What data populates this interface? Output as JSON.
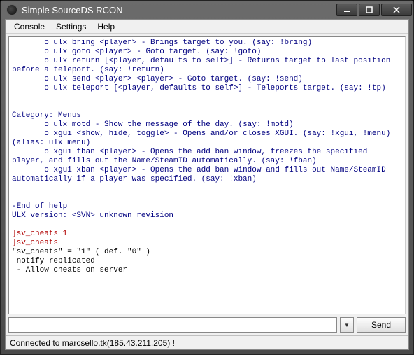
{
  "window": {
    "title": "Simple SourceDS RCON"
  },
  "menu": {
    "console": "Console",
    "settings": "Settings",
    "help": "Help"
  },
  "console": {
    "lines": [
      {
        "c": "blue",
        "t": "       o ulx bring <player> - Brings target to you. (say: !bring)"
      },
      {
        "c": "blue",
        "t": "       o ulx goto <player> - Goto target. (say: !goto)"
      },
      {
        "c": "blue",
        "t": "       o ulx return [<player, defaults to self>] - Returns target to last position before a teleport. (say: !return)"
      },
      {
        "c": "blue",
        "t": "       o ulx send <player> <player> - Goto target. (say: !send)"
      },
      {
        "c": "blue",
        "t": "       o ulx teleport [<player, defaults to self>] - Teleports target. (say: !tp)"
      },
      {
        "c": "blue",
        "t": ""
      },
      {
        "c": "blue",
        "t": ""
      },
      {
        "c": "blue",
        "t": "Category: Menus"
      },
      {
        "c": "blue",
        "t": "       o ulx motd - Show the message of the day. (say: !motd)"
      },
      {
        "c": "blue",
        "t": "       o xgui <show, hide, toggle> - Opens and/or closes XGUI. (say: !xgui, !menu) (alias: ulx menu)"
      },
      {
        "c": "blue",
        "t": "       o xgui fban <player> - Opens the add ban window, freezes the specified player, and fills out the Name/SteamID automatically. (say: !fban)"
      },
      {
        "c": "blue",
        "t": "       o xgui xban <player> - Opens the add ban window and fills out Name/SteamID automatically if a player was specified. (say: !xban)"
      },
      {
        "c": "blue",
        "t": ""
      },
      {
        "c": "blue",
        "t": ""
      },
      {
        "c": "blue",
        "t": "-End of help"
      },
      {
        "c": "blue",
        "t": "ULX version: <SVN> unknown revision"
      },
      {
        "c": "blue",
        "t": ""
      },
      {
        "c": "red",
        "t": "]sv_cheats 1"
      },
      {
        "c": "red",
        "t": "]sv_cheats"
      },
      {
        "c": "black",
        "t": "\"sv_cheats\" = \"1\" ( def. \"0\" )"
      },
      {
        "c": "black",
        "t": " notify replicated"
      },
      {
        "c": "black",
        "t": " - Allow cheats on server"
      },
      {
        "c": "black",
        "t": ""
      }
    ]
  },
  "input": {
    "value": "",
    "send_label": "Send",
    "dropdown_glyph": "▼"
  },
  "status": {
    "text": "Connected to marcsello.tk(185.43.211.205) !"
  }
}
